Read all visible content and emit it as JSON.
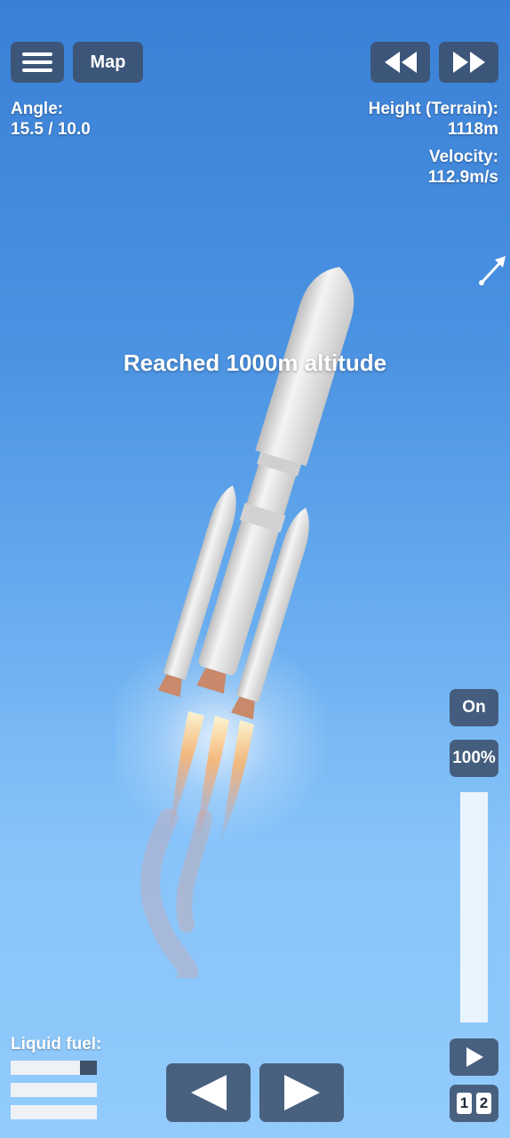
{
  "top_bar": {
    "menu_icon": "hamburger-menu-icon",
    "map_label": "Map",
    "rewind_icon": "rewind-icon",
    "fast_forward_icon": "fast-forward-icon"
  },
  "telemetry": {
    "angle_label": "Angle:",
    "angle_value": "15.5 / 10.0",
    "height_label": "Height (Terrain):",
    "height_value": "1118m",
    "velocity_label": "Velocity:",
    "velocity_value": "112.9m/s"
  },
  "notification": "Reached 1000m altitude",
  "direction_icon": "velocity-direction-arrow-icon",
  "engine": {
    "toggle_label": "On",
    "throttle_label": "100%",
    "throttle_fraction": 1.0
  },
  "fuel": {
    "label": "Liquid fuel:",
    "bars": [
      0.2,
      0.0,
      0.0
    ]
  },
  "controls": {
    "rotate_left_icon": "rotate-left-triangle-icon",
    "rotate_right_icon": "rotate-right-triangle-icon",
    "stage_icon": "play-stage-icon",
    "stage_numbers": [
      "1",
      "2"
    ]
  },
  "colors": {
    "sky_top": "#3a80d6",
    "sky_bottom": "#92cbfc",
    "button_bg": "#3c4e68",
    "fuel_fill": "#3e5168",
    "bar_bg": "#eef2f6"
  }
}
